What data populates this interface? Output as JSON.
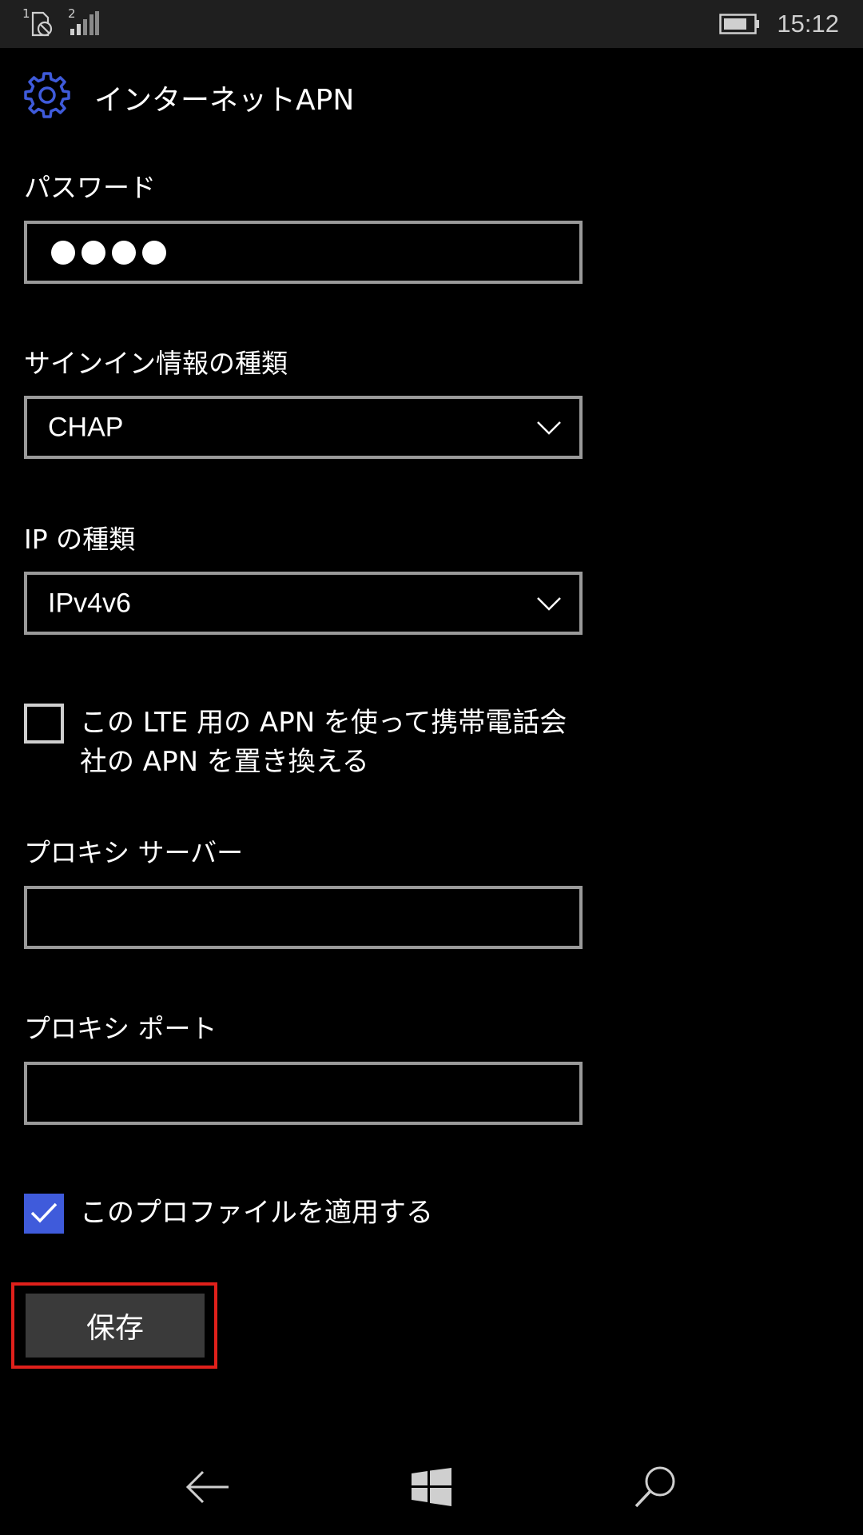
{
  "status_bar": {
    "sim1_label": "1",
    "sim2_label": "2",
    "time": "15:12",
    "icons": [
      "sim1-no-service-icon",
      "signal-strength-icon",
      "battery-icon"
    ]
  },
  "header": {
    "title": "インターネットAPN",
    "icon": "gear-icon",
    "accent_color": "#3f5bdb"
  },
  "form": {
    "password": {
      "label": "パスワード",
      "masked_dots": 4
    },
    "sign_in_type": {
      "label": "サインイン情報の種類",
      "value": "CHAP"
    },
    "ip_type": {
      "label": "IP の種類",
      "value": "IPv4v6"
    },
    "lte_replace": {
      "label_line1": "この LTE 用の APN を使って携帯電話会",
      "label_line2": "社の APN を置き換える",
      "checked": false
    },
    "proxy_server": {
      "label": "プロキシ サーバー",
      "value": ""
    },
    "proxy_port": {
      "label": "プロキシ ポート",
      "value": ""
    },
    "apply_profile": {
      "label": "このプロファイルを適用する",
      "checked": true
    },
    "save_label": "保存",
    "highlight_color": "#e0201b"
  },
  "nav": {
    "icons": [
      "back-arrow-icon",
      "windows-start-icon",
      "search-icon"
    ]
  }
}
